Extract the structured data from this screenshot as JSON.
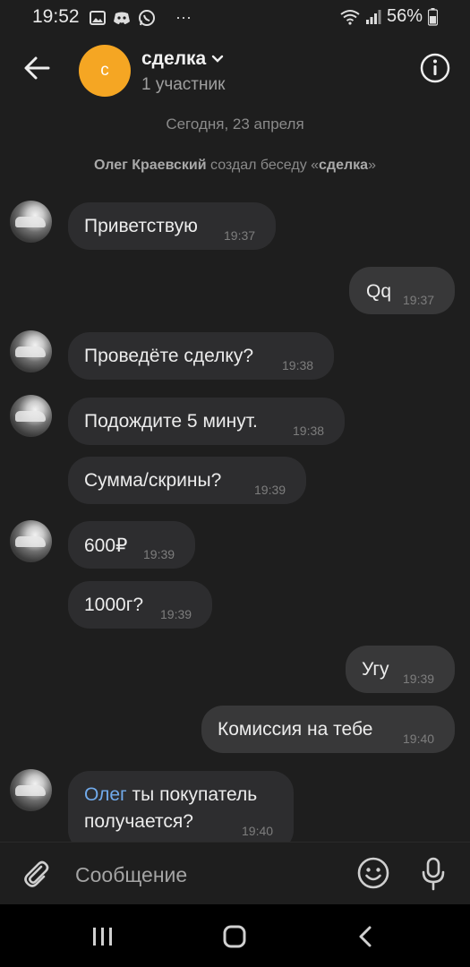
{
  "status": {
    "time": "19:52",
    "more": "···",
    "battery": "56%"
  },
  "header": {
    "avatar_letter": "с",
    "title": "сделка",
    "subtitle": "1 участник"
  },
  "date_separator": "Сегодня, 23 апреля",
  "system": {
    "author": "Олег Краевский",
    "action": " создал беседу «",
    "chat": "сделка",
    "end": "»"
  },
  "messages": [
    {
      "text": "Приветствую",
      "time": "19:37"
    },
    {
      "text": "Qq",
      "time": "19:37"
    },
    {
      "text": "Проведёте сделку?",
      "time": "19:38"
    },
    {
      "text": "Подождите 5 минут.",
      "time": "19:38"
    },
    {
      "text": "Сумма/скрины?",
      "time": "19:39"
    },
    {
      "text": "600₽",
      "time": "19:39"
    },
    {
      "text": "1000г?",
      "time": "19:39"
    },
    {
      "text": "Угу",
      "time": "19:39"
    },
    {
      "text": "Комиссия на тебе",
      "time": "19:40"
    },
    {
      "mention": "Олег",
      "text": " ты покупатель",
      "text2": "получается?",
      "time": "19:40"
    }
  ],
  "composer": {
    "placeholder": "Сообщение"
  },
  "colors": {
    "background": "#1e1e1e",
    "bubble_in": "#2d2d2f",
    "bubble_out": "#383839",
    "avatar": "#f5a623",
    "mention": "#71aaeb"
  }
}
